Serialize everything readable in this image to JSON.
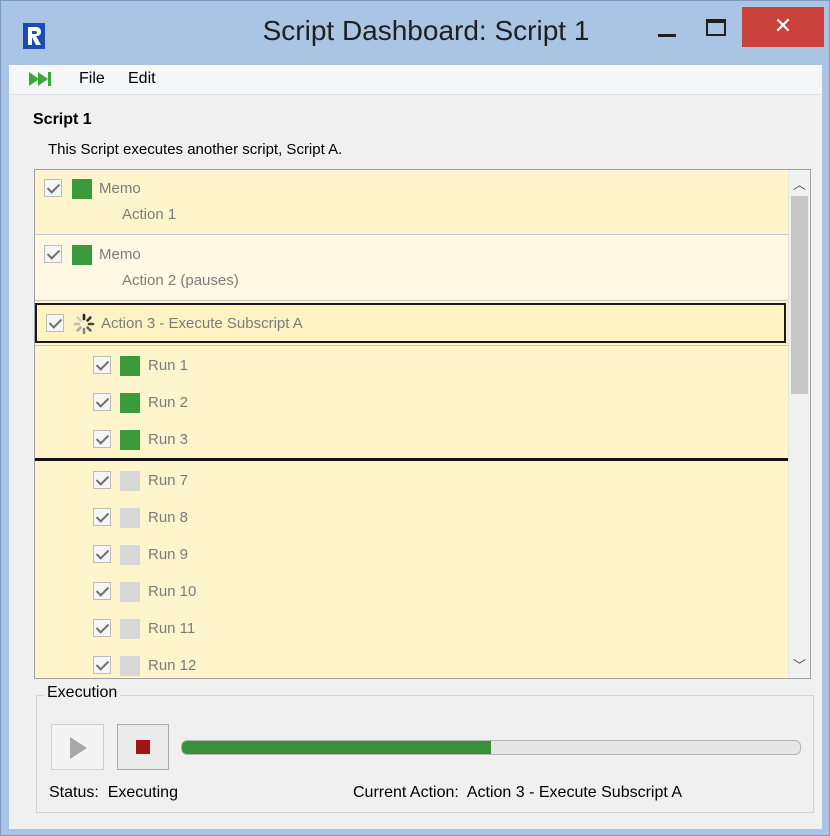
{
  "window": {
    "title": "Script Dashboard: Script 1",
    "close_glyph": "✕"
  },
  "menu": {
    "items": [
      "File",
      "Edit"
    ]
  },
  "script": {
    "name": "Script 1",
    "description": "This Script executes another script, Script A."
  },
  "actions": [
    {
      "title": "Memo",
      "subtitle": "Action 1",
      "checked": true,
      "state": "complete"
    },
    {
      "title": "Memo",
      "subtitle": "Action 2 (pauses)",
      "checked": true,
      "state": "complete"
    },
    {
      "title": "Action 3 - Execute Subscript A",
      "checked": true,
      "state": "running"
    }
  ],
  "runs": [
    {
      "label": "Run 1",
      "state": "complete"
    },
    {
      "label": "Run 2",
      "state": "complete"
    },
    {
      "label": "Run 3",
      "state": "complete"
    },
    {
      "label": "Run 7",
      "state": "pending"
    },
    {
      "label": "Run 8",
      "state": "pending"
    },
    {
      "label": "Run 9",
      "state": "pending"
    },
    {
      "label": "Run 10",
      "state": "pending"
    },
    {
      "label": "Run 11",
      "state": "pending"
    },
    {
      "label": "Run 12",
      "state": "pending"
    }
  ],
  "execution": {
    "group_label": "Execution",
    "progress_percent": 50,
    "status_label": "Status:",
    "status_value": "Executing",
    "current_action_label": "Current Action:",
    "current_action_value": "Action 3 - Execute Subscript A"
  },
  "colors": {
    "complete": "#3a9a3c",
    "pending": "#d7d7d7",
    "row_bg": "#fff5cc",
    "stop": "#a31515",
    "close": "#c9413a"
  }
}
